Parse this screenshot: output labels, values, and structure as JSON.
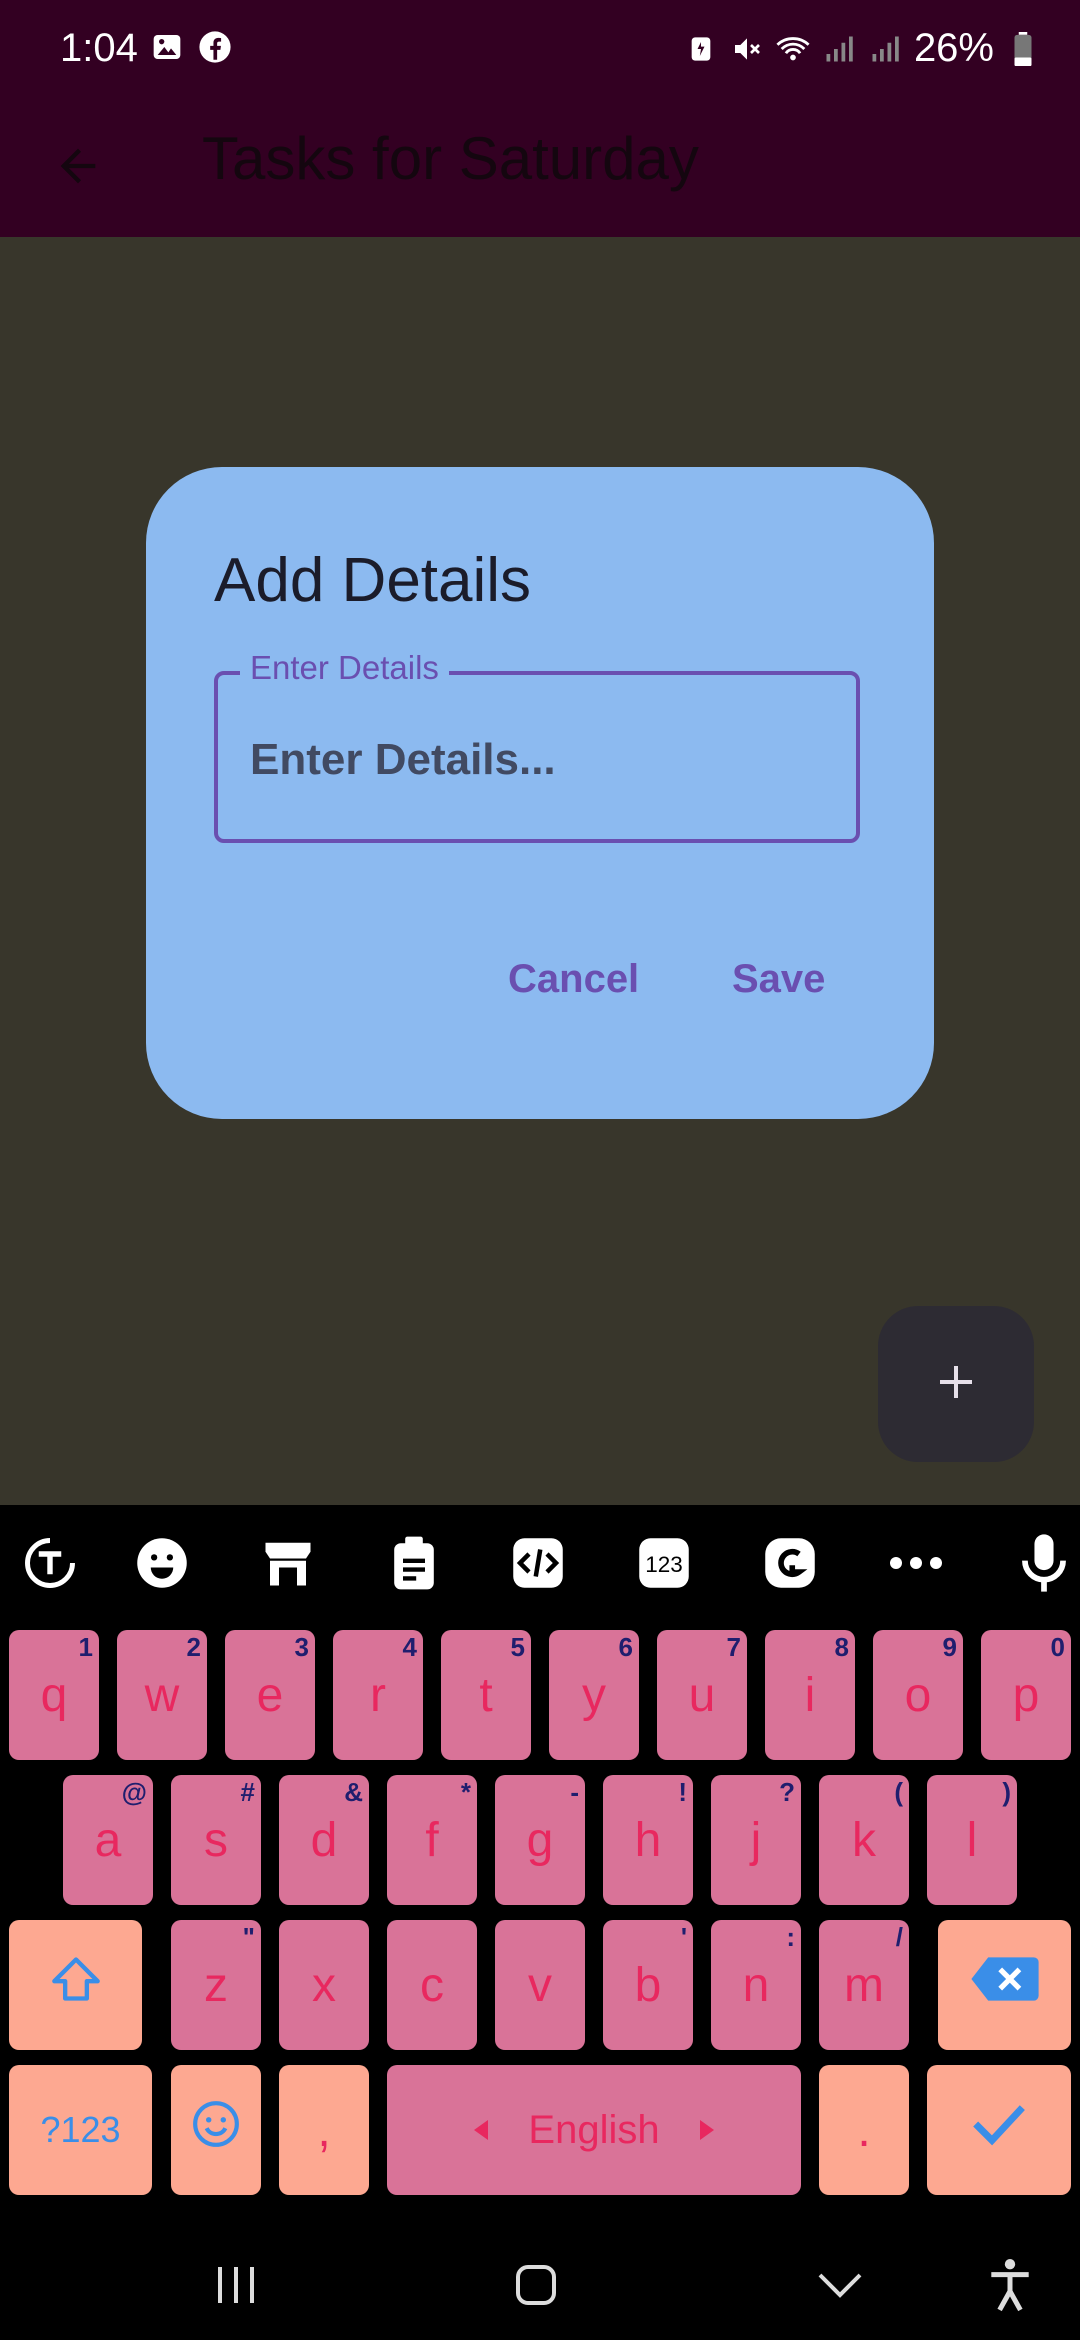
{
  "status_bar": {
    "time": "1:04",
    "battery": "26%",
    "left_icons": [
      "image-icon",
      "facebook-icon"
    ],
    "right_icons": [
      "battery-saver-icon",
      "mute-icon",
      "wifi-icon",
      "signal-icon",
      "signal-icon",
      "battery-icon"
    ]
  },
  "app_bar": {
    "title": "Tasks for Saturday",
    "back_icon": "arrow-back-icon"
  },
  "dialog": {
    "title": "Add Details",
    "field_label": "Enter Details",
    "field_placeholder": "Enter Details...",
    "field_value": "",
    "cancel_label": "Cancel",
    "save_label": "Save"
  },
  "fab": {
    "icon": "plus-icon"
  },
  "keyboard": {
    "toolbar": [
      "text-translate-icon",
      "emoji-icon",
      "store-icon",
      "clipboard-icon",
      "code-icon",
      "numpad-icon",
      "grammar-icon",
      "more-icon",
      "mic-icon"
    ],
    "row1": [
      {
        "key": "q",
        "hint": "1"
      },
      {
        "key": "w",
        "hint": "2"
      },
      {
        "key": "e",
        "hint": "3"
      },
      {
        "key": "r",
        "hint": "4"
      },
      {
        "key": "t",
        "hint": "5"
      },
      {
        "key": "y",
        "hint": "6"
      },
      {
        "key": "u",
        "hint": "7"
      },
      {
        "key": "i",
        "hint": "8"
      },
      {
        "key": "o",
        "hint": "9"
      },
      {
        "key": "p",
        "hint": "0"
      }
    ],
    "row2": [
      {
        "key": "a",
        "hint": "@"
      },
      {
        "key": "s",
        "hint": "#"
      },
      {
        "key": "d",
        "hint": "&"
      },
      {
        "key": "f",
        "hint": "*"
      },
      {
        "key": "g",
        "hint": "-"
      },
      {
        "key": "h",
        "hint": "!"
      },
      {
        "key": "j",
        "hint": "?"
      },
      {
        "key": "k",
        "hint": "("
      },
      {
        "key": "l",
        "hint": ")"
      }
    ],
    "row3": [
      {
        "key": "z",
        "hint": "\""
      },
      {
        "key": "x",
        "hint": ""
      },
      {
        "key": "c",
        "hint": ""
      },
      {
        "key": "v",
        "hint": ""
      },
      {
        "key": "b",
        "hint": "'"
      },
      {
        "key": "n",
        "hint": ":"
      },
      {
        "key": "m",
        "hint": "/"
      }
    ],
    "sym_label": "?123",
    "comma": ",",
    "space_label": "English",
    "period": ".",
    "shift_icon": "shift-icon",
    "backspace_icon": "backspace-icon",
    "emoji_key_icon": "emoji-icon",
    "enter_icon": "check-icon"
  },
  "nav_bar": [
    "recents-icon",
    "home-icon",
    "hide-keyboard-icon",
    "accessibility-icon"
  ],
  "colors": {
    "app_bar": "#330022",
    "scrim": "#38362b",
    "dialog": "#8cbaf0",
    "accent": "#6a4fb0",
    "key": "#d97398",
    "key_special": "#fda891",
    "key_text": "#e8285f",
    "hint_text": "#1f1e6e"
  }
}
